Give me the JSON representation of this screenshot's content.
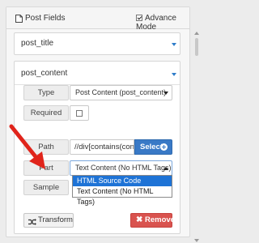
{
  "header": {
    "title": "Post Fields",
    "advance_mode_label": "Advance Mode",
    "advance_mode_checked": true
  },
  "fields": [
    {
      "label": "post_title"
    },
    {
      "label": "post_content"
    }
  ],
  "post_content_config": {
    "type_label": "Type",
    "type_value": "Post Content (post_content)",
    "required_label": "Required",
    "required_checked": false,
    "path_label": "Path",
    "path_value": "//div[contains(con",
    "select_button": "Select",
    "part_label": "Part",
    "part_value": "Text Content (No HTML Tags)",
    "part_options": [
      "HTML Source Code",
      "Text Content (No HTML Tags)"
    ],
    "part_highlighted": "HTML Source Code",
    "sample_label": "Sample"
  },
  "actions": {
    "transform_label": "Transform",
    "remove_label": "Remove"
  },
  "colors": {
    "accent_blue": "#3979c6",
    "danger_red": "#d9534f",
    "highlight": "#1e73d6",
    "arrow_red": "#e0241b"
  },
  "icons": {
    "header": "file-icon",
    "transform": "shuffle-icon",
    "remove": "x-icon",
    "select": "plus-circle-icon"
  }
}
